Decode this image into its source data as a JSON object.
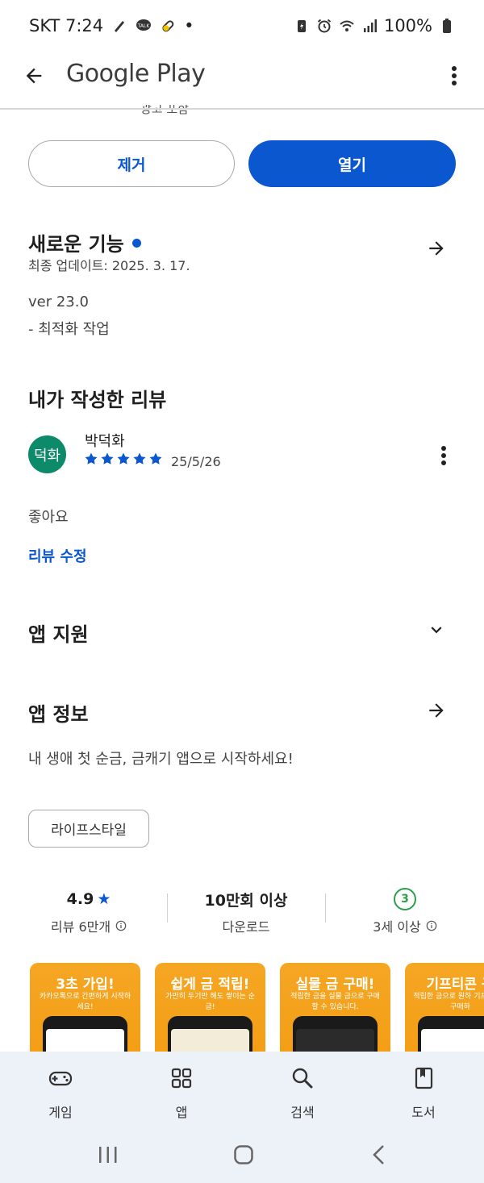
{
  "status_bar": {
    "carrier_time": "SKT 7:24",
    "battery": "100%",
    "dot": "•"
  },
  "app_bar": {
    "title": "Google Play"
  },
  "partial_header_text": "광고 포함",
  "actions": {
    "remove_label": "제거",
    "open_label": "열기"
  },
  "whats_new": {
    "title": "새로운 기능",
    "last_updated": "최종 업데이트: 2025. 3. 17.",
    "version": "ver 23.0",
    "notes": "- 최적화 작업"
  },
  "my_review": {
    "title": "내가 작성한 리뷰",
    "avatar_text": "덕화",
    "reviewer_name": "박덕화",
    "rating": 5,
    "date": "25/5/26",
    "body": "좋아요",
    "edit_label": "리뷰 수정"
  },
  "app_support": {
    "title": "앱 지원"
  },
  "app_info": {
    "title": "앱 정보",
    "description": "내 생애 첫 순금, 금캐기 앱으로 시작하세요!",
    "category_chip": "라이프스타일"
  },
  "stats": {
    "rating_value": "4.9",
    "rating_star": "★",
    "rating_label": "리뷰 6만개",
    "downloads_value": "10만회 이상",
    "downloads_label": "다운로드",
    "age_badge": "3",
    "age_label": "3세 이상"
  },
  "screenshots": [
    {
      "title": "3초 가입!",
      "subtitle": "카카오톡으로 간편하게 시작하세요!"
    },
    {
      "title": "쉽게 금 적립!",
      "subtitle": "가만히 두기만 해도 쌓이는 순금!"
    },
    {
      "title": "실물 금 구매!",
      "subtitle": "적립한 금을 실물 금으로 구매 할 수 있습니다."
    },
    {
      "title": "기프티콘 구",
      "subtitle": "적립한 금으로 원하 기프티콘을 구매하"
    }
  ],
  "bottom_nav": {
    "items": [
      {
        "label": "게임",
        "icon": "gamepad-icon"
      },
      {
        "label": "앱",
        "icon": "apps-grid-icon"
      },
      {
        "label": "검색",
        "icon": "search-icon"
      },
      {
        "label": "도서",
        "icon": "book-icon"
      }
    ]
  },
  "colors": {
    "accent": "#0b57d0",
    "avatar_bg": "#0d8a6a",
    "age_green": "#2e9e4a",
    "screenshot_orange": "#f5a623",
    "nav_bg": "#edf1f8"
  }
}
